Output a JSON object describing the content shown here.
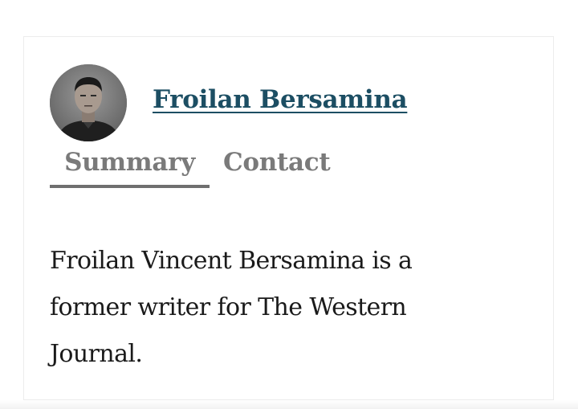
{
  "author": {
    "name": "Froilan Bersamina"
  },
  "tabs": [
    {
      "label": "Summary",
      "active": true
    },
    {
      "label": "Contact",
      "active": false
    }
  ],
  "summary": {
    "text": "Froilan Vincent Bersamina is a former writer for The Western Journal."
  },
  "colors": {
    "name_link": "#1c4e63",
    "tab_text": "#7a7a7a",
    "body_text": "#1a1a1a",
    "card_border": "#ececec"
  },
  "icons": {
    "avatar": "author-avatar-photo"
  }
}
